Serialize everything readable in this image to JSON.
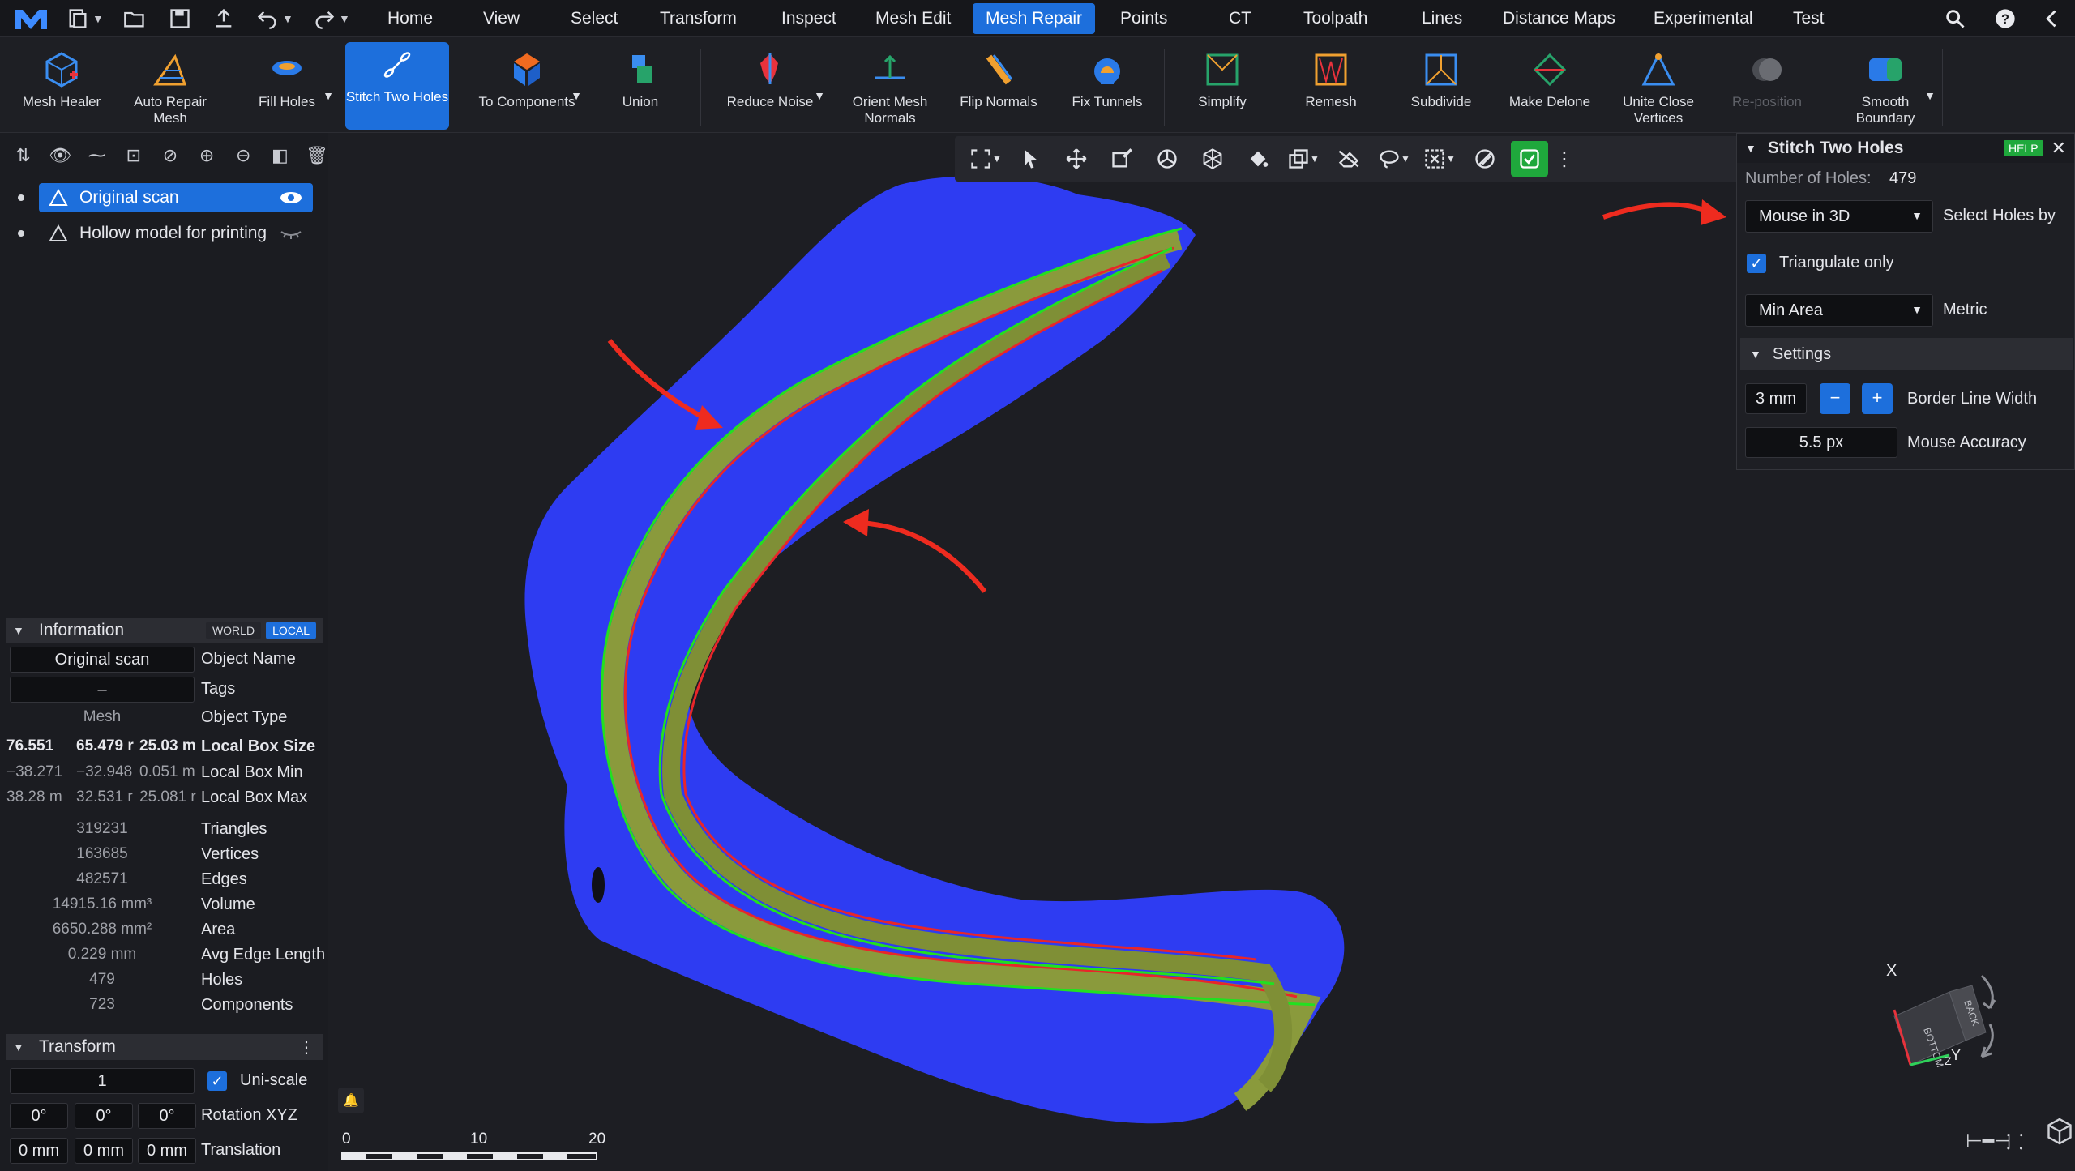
{
  "menubar": {
    "items": [
      "Home",
      "View",
      "Select",
      "Transform",
      "Inspect",
      "Mesh Edit",
      "Mesh Repair",
      "Points",
      "CT",
      "Toolpath",
      "Lines",
      "Distance Maps",
      "Experimental",
      "Test"
    ],
    "active": "Mesh Repair"
  },
  "ribbon": {
    "buttons": [
      {
        "label": "Mesh Healer"
      },
      {
        "label": "Auto Repair Mesh"
      },
      {
        "label": "Fill Holes"
      },
      {
        "label": "Stitch Two Holes"
      },
      {
        "label": "To Components"
      },
      {
        "label": "Union"
      },
      {
        "label": "Reduce Noise"
      },
      {
        "label": "Orient Mesh Normals"
      },
      {
        "label": "Flip Normals"
      },
      {
        "label": "Fix Tunnels"
      },
      {
        "label": "Simplify"
      },
      {
        "label": "Remesh"
      },
      {
        "label": "Subdivide"
      },
      {
        "label": "Make Delone"
      },
      {
        "label": "Unite Close Vertices"
      },
      {
        "label": "Re-position"
      },
      {
        "label": "Smooth Boundary"
      }
    ]
  },
  "scene_tree": {
    "items": [
      {
        "label": "Original scan"
      },
      {
        "label": "Hollow model for printing"
      }
    ]
  },
  "information": {
    "title": "Information",
    "world": "WORLD",
    "local": "LOCAL",
    "object_name": "Original scan",
    "object_name_label": "Object Name",
    "tags": "–",
    "tags_label": "Tags",
    "object_type": "Mesh",
    "object_type_label": "Object Type",
    "box_size": [
      "76.551",
      "65.479 r",
      "25.03 m"
    ],
    "box_size_label": "Local Box Size",
    "box_min": [
      "−38.271",
      "−32.948",
      "0.051 m"
    ],
    "box_min_label": "Local Box Min",
    "box_max": [
      "38.28 m",
      "32.531 r",
      "25.081 r"
    ],
    "box_max_label": "Local Box Max",
    "stats": [
      {
        "value": "319231",
        "label": "Triangles"
      },
      {
        "value": "163685",
        "label": "Vertices"
      },
      {
        "value": "482571",
        "label": "Edges"
      },
      {
        "value": "14915.16 mm³",
        "label": "Volume"
      },
      {
        "value": "6650.288 mm²",
        "label": "Area"
      },
      {
        "value": "0.229 mm",
        "label": "Avg Edge Length"
      },
      {
        "value": "479",
        "label": "Holes"
      },
      {
        "value": "723",
        "label": "Components"
      }
    ]
  },
  "transform": {
    "title": "Transform",
    "scale": "1",
    "uniscale": "Uni-scale",
    "rotation": [
      "0°",
      "0°",
      "0°"
    ],
    "rotation_label": "Rotation XYZ",
    "translation": [
      "0 mm",
      "0 mm",
      "0 mm"
    ],
    "translation_label": "Translation"
  },
  "stitch_panel": {
    "title": "Stitch Two Holes",
    "help": "HELP",
    "holes_label": "Number of Holes:",
    "holes_value": "479",
    "select_mode": "Mouse in 3D",
    "select_label": "Select Holes by",
    "triangulate": "Triangulate only",
    "metric_value": "Min Area",
    "metric_label": "Metric",
    "settings": "Settings",
    "border_width": "3 mm",
    "border_width_label": "Border Line Width",
    "mouse_accuracy": "5.5 px",
    "mouse_accuracy_label": "Mouse Accuracy"
  },
  "scale_bar": {
    "ticks": [
      "0",
      "10",
      "20"
    ]
  },
  "gizmo": {
    "x": "X",
    "y": "Y",
    "z": "Z",
    "bottom": "BOTTOM",
    "back": "BACK"
  },
  "colors": {
    "accent": "#1d6fdc",
    "mesh": "#2e3cf2",
    "green": "#1fa83c",
    "border_red": "#e8262a"
  }
}
